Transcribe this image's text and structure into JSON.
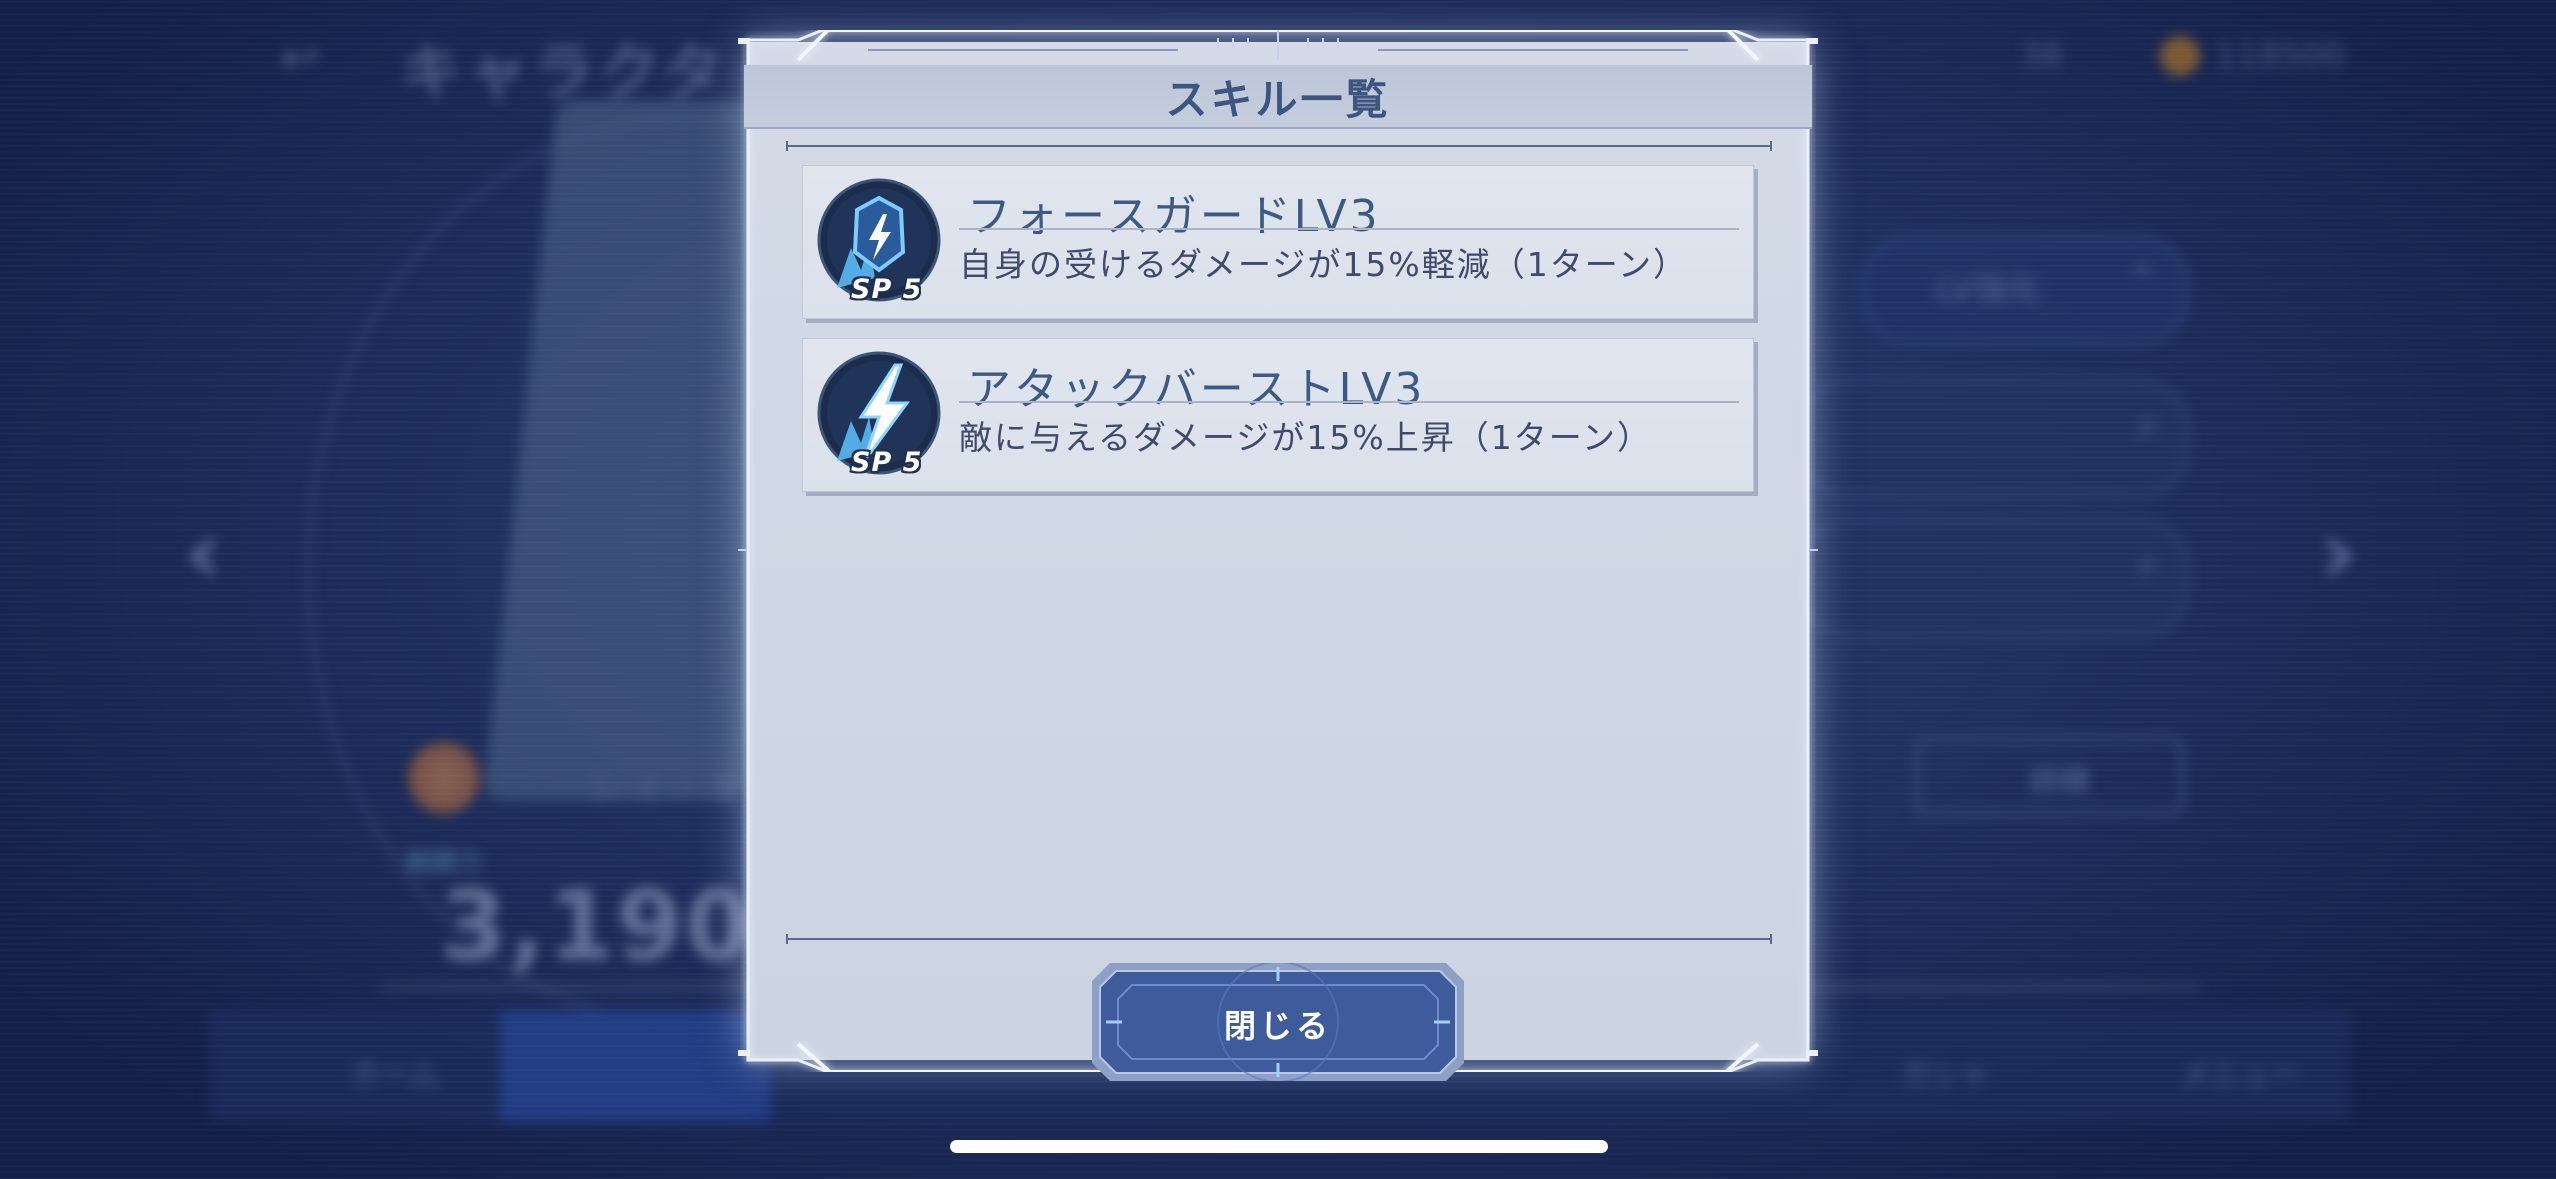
{
  "background": {
    "screen_title": "キャラクタ",
    "level_button": "LV強化",
    "detail_button": "詳細",
    "power_label": "戦闘力",
    "power_value": "3,190",
    "character_name": "レイ・ザ",
    "resource_1": "38",
    "resource_2": "118500",
    "nav": {
      "home": "ホーム",
      "gacha": "ガシャ",
      "menu": "メニュー"
    }
  },
  "modal": {
    "title": "スキル一覧",
    "close_label": "閉じる",
    "skills": [
      {
        "name": "フォースガードLV3",
        "description": "自身の受けるダメージが15%軽減（1ターン）",
        "sp": "SP 5",
        "icon": "shield-lightning-icon"
      },
      {
        "name": "アタックバーストLV3",
        "description": "敵に与えるダメージが15%上昇（1ターン）",
        "sp": "SP 5",
        "icon": "lightning-bolt-icon"
      }
    ]
  },
  "colors": {
    "panel": "#d4dbe7",
    "title": "#3d557f",
    "skill_icon_glow": "#59b8ff",
    "button": "#4a6aa8"
  }
}
